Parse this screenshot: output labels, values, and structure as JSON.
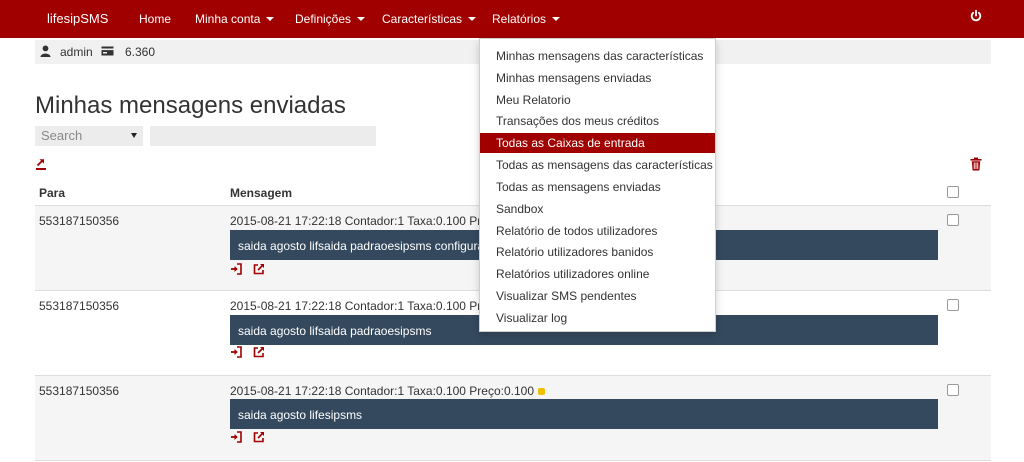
{
  "navbar": {
    "brand": "lifesipSMS",
    "items": [
      {
        "label": "Home"
      },
      {
        "label": "Minha conta"
      },
      {
        "label": "Definições"
      },
      {
        "label": "Características"
      },
      {
        "label": "Relatórios"
      }
    ],
    "icons": {
      "logout": "power-icon"
    }
  },
  "userbar": {
    "username": "admin",
    "credits": "6.360",
    "icons": {
      "user": "user-icon",
      "credits": "credit-card-icon"
    }
  },
  "page": {
    "title": "Minhas mensagens enviadas"
  },
  "search": {
    "select_value": "Search",
    "input_value": ""
  },
  "table": {
    "headers": {
      "para": "Para",
      "mensagem": "Mensagem"
    },
    "rows": [
      {
        "para": "553187150356",
        "meta": "2015-08-21 17:22:18 Contador:1 Taxa:0.100 Preço:0.100",
        "message": "saida agosto lifsaida padraoesipsms configurado"
      },
      {
        "para": "553187150356",
        "meta": "2015-08-21 17:22:18 Contador:1 Taxa:0.100 Preço:0.100",
        "message": "saida agosto lifsaida padraoesipsms"
      },
      {
        "para": "553187150356",
        "meta": "2015-08-21 17:22:18 Contador:1 Taxa:0.100 Preço:0.100",
        "message": "saida agosto lifesipsms"
      }
    ]
  },
  "dropdown": {
    "items": [
      {
        "label": "Minhas mensagens das características"
      },
      {
        "label": "Minhas mensagens enviadas"
      },
      {
        "label": "Meu Relatorio"
      },
      {
        "label": "Transações dos meus créditos"
      },
      {
        "label": "Todas as Caixas de entrada"
      },
      {
        "label": "Todas as mensagens das características"
      },
      {
        "label": "Todas as mensagens enviadas"
      },
      {
        "label": "Sandbox"
      },
      {
        "label": "Relatório de todos utilizadores"
      },
      {
        "label": "Relatório utilizadores banidos"
      },
      {
        "label": "Relatórios utilizadores online"
      },
      {
        "label": "Visualizar SMS pendentes"
      },
      {
        "label": "Visualizar log"
      }
    ],
    "active_label": "Todas as Caixas de entrada"
  },
  "colors": {
    "brand_red": "#a00000",
    "message_bg": "#34495e",
    "status_dot": "#f0c000"
  }
}
